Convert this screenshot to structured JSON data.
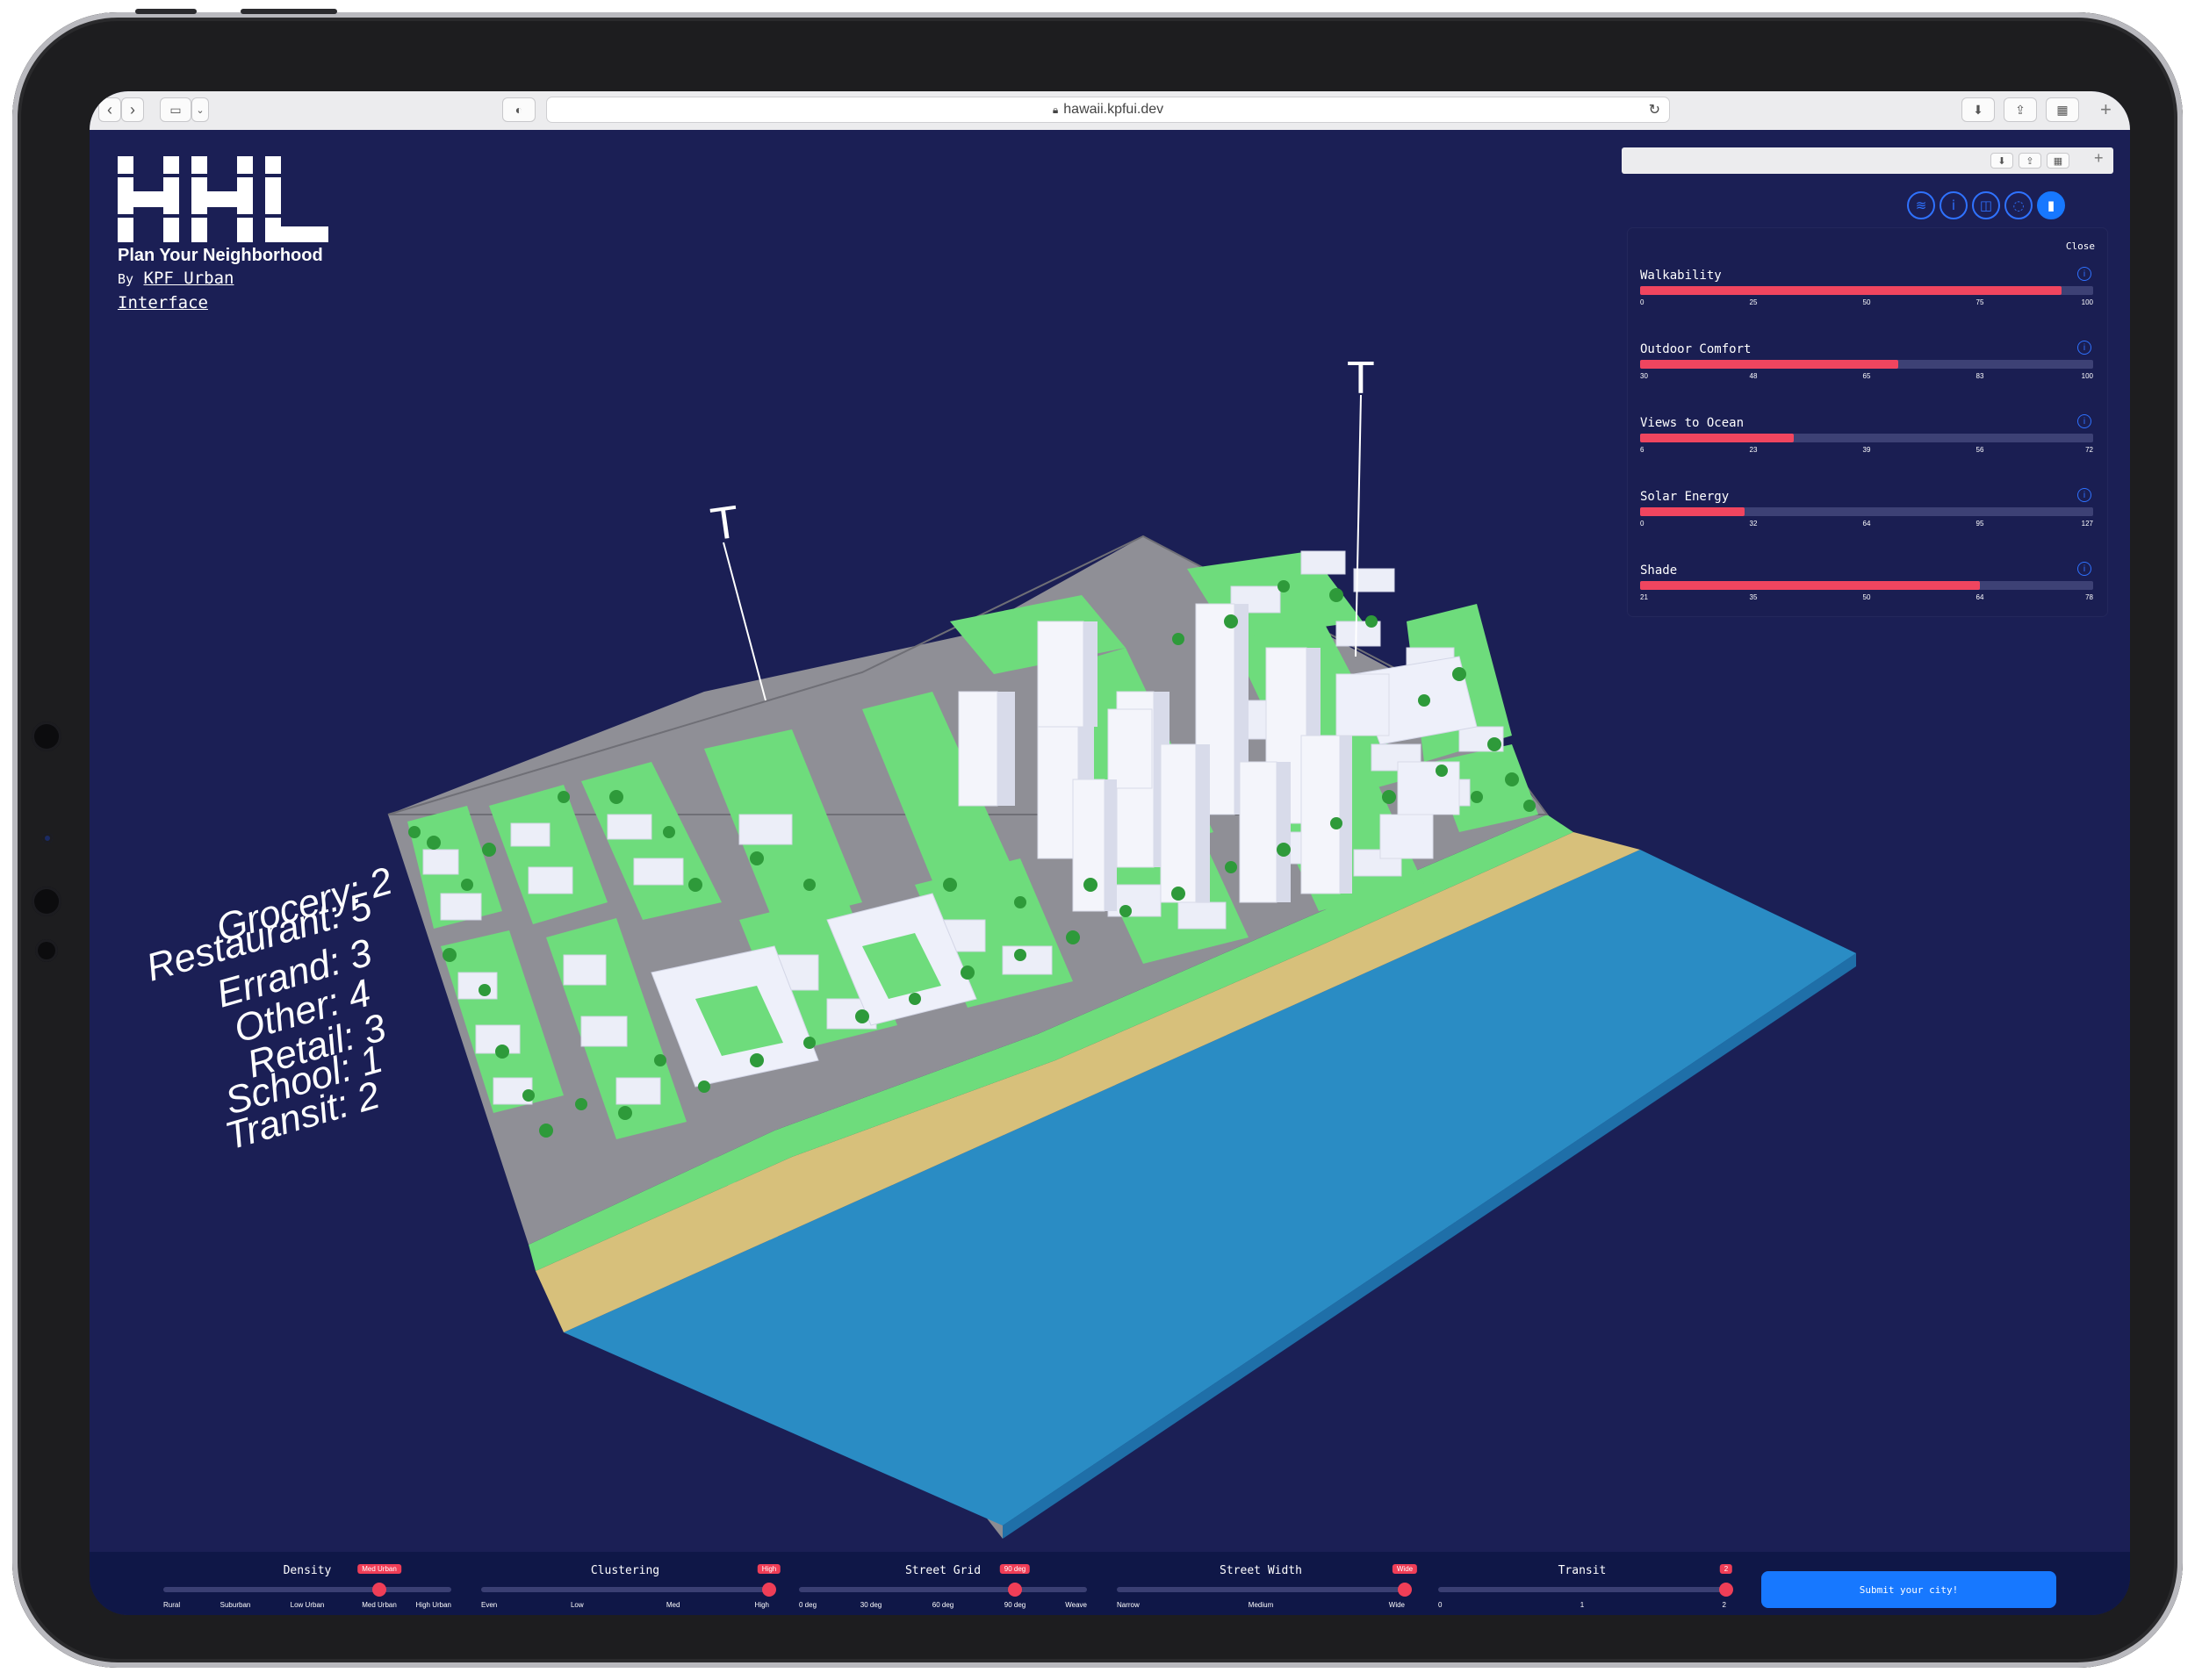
{
  "browser": {
    "url": "hawaii.kpfui.dev"
  },
  "app": {
    "logo_text": "HHL",
    "subtitle": "Plan Your Neighborhood",
    "byline_prefix": "By",
    "byline_link": "KPF Urban",
    "interface_link": "Interface",
    "transit_marker": "T"
  },
  "amenities": [
    {
      "text": "Grocery: 2"
    },
    {
      "text": "Restaurant: 5"
    },
    {
      "text": "Errand: 3"
    },
    {
      "text": "Other: 4"
    },
    {
      "text": "Retail: 3"
    },
    {
      "text": "School: 1"
    },
    {
      "text": "Transit: 2"
    }
  ],
  "panel": {
    "close_label": "Close",
    "icons": [
      "layers-icon",
      "info-icon",
      "camera-icon",
      "chat-icon",
      "chart-icon"
    ],
    "metrics": [
      {
        "title": "Walkability",
        "fraction": 0.93,
        "ticks": [
          "0",
          "25",
          "50",
          "75",
          "100"
        ]
      },
      {
        "title": "Outdoor Comfort",
        "fraction": 0.57,
        "ticks": [
          "30",
          "48",
          "65",
          "83",
          "100"
        ]
      },
      {
        "title": "Views to Ocean",
        "fraction": 0.34,
        "ticks": [
          "6",
          "23",
          "39",
          "56",
          "72"
        ]
      },
      {
        "title": "Solar Energy",
        "fraction": 0.23,
        "ticks": [
          "0",
          "32",
          "64",
          "95",
          "127"
        ]
      },
      {
        "title": "Shade",
        "fraction": 0.75,
        "ticks": [
          "21",
          "35",
          "50",
          "64",
          "78"
        ]
      }
    ]
  },
  "controls": [
    {
      "title": "Density",
      "selected": "Med Urban",
      "position": 0.75,
      "labels": [
        "Rural",
        "Suburban",
        "Low Urban",
        "Med Urban",
        "High Urban"
      ]
    },
    {
      "title": "Clustering",
      "selected": "High",
      "position": 1.0,
      "labels": [
        "Even",
        "Low",
        "Med",
        "High"
      ]
    },
    {
      "title": "Street Grid",
      "selected": "90 deg",
      "position": 0.75,
      "labels": [
        "0 deg",
        "30 deg",
        "60 deg",
        "90 deg",
        "Weave"
      ]
    },
    {
      "title": "Street Width",
      "selected": "Wide",
      "position": 1.0,
      "labels": [
        "Narrow",
        "Medium",
        "Wide"
      ]
    },
    {
      "title": "Transit",
      "selected": "2",
      "position": 1.0,
      "labels": [
        "0",
        "1",
        "2"
      ]
    }
  ],
  "submit_label": "Submit your city!"
}
